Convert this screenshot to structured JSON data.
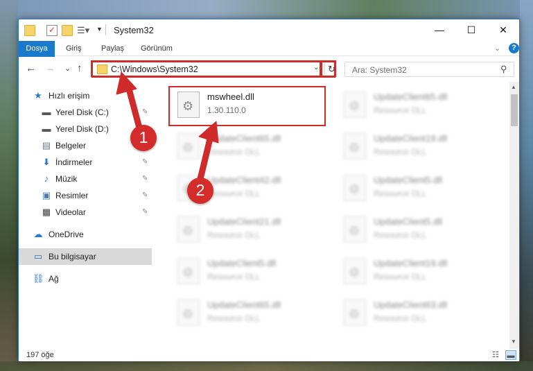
{
  "window": {
    "title": "System32",
    "minimize_glyph": "—",
    "maximize_glyph": "☐",
    "close_glyph": "✕"
  },
  "ribbon": {
    "tabs": [
      "Dosya",
      "Giriş",
      "Paylaş",
      "Görünüm"
    ],
    "expand_glyph": "⌄",
    "help_glyph": "?"
  },
  "nav": {
    "back_glyph": "←",
    "forward_glyph": "→",
    "recent_glyph": "⌄",
    "up_glyph": "↑",
    "address": "C:\\Windows\\System32",
    "address_dropdown_glyph": "⌄",
    "refresh_glyph": "↻",
    "search_placeholder": "Ara: System32",
    "search_icon": "search-icon"
  },
  "sidebar": {
    "items": [
      {
        "label": "Hızlı erişim",
        "icon": "★",
        "pinned": false
      },
      {
        "label": "Yerel Disk (C:)",
        "icon": "▬",
        "pinned": true
      },
      {
        "label": "Yerel Disk (D:)",
        "icon": "▬",
        "pinned": true
      },
      {
        "label": "Belgeler",
        "icon": "▤",
        "pinned": true
      },
      {
        "label": "İndirmeler",
        "icon": "⬇",
        "pinned": true
      },
      {
        "label": "Müzik",
        "icon": "♪",
        "pinned": true
      },
      {
        "label": "Resimler",
        "icon": "▣",
        "pinned": true
      },
      {
        "label": "Videolar",
        "icon": "▦",
        "pinned": true
      },
      {
        "label": "OneDrive",
        "icon": "☁",
        "pinned": false
      },
      {
        "label": "Bu bilgisayar",
        "icon": "▭",
        "pinned": false,
        "selected": true
      },
      {
        "label": "Ağ",
        "icon": "⛓",
        "pinned": false
      }
    ],
    "pin_glyph": "📌"
  },
  "files": [
    {
      "name": "mswheel.dll",
      "desc": "1.30.110.0",
      "highlighted": true
    },
    {
      "name": "UpdateClient65.dll",
      "desc": "Resource DLL"
    },
    {
      "name": "UpdateClient65.dll",
      "desc": "Resource DLL"
    },
    {
      "name": "UpdateClient19.dll",
      "desc": "Resource DLL"
    },
    {
      "name": "UpdateClient42.dll",
      "desc": "Resource DLL"
    },
    {
      "name": "UpdateClient5.dll",
      "desc": "Resource DLL"
    },
    {
      "name": "UpdateClient21.dll",
      "desc": "Resource DLL"
    },
    {
      "name": "UpdateClient5.dll",
      "desc": "Resource DLL"
    },
    {
      "name": "UpdateClient5.dll",
      "desc": "Resource DLL"
    },
    {
      "name": "UpdateClient19.dll",
      "desc": "Resource DLL"
    },
    {
      "name": "UpdateClient65.dll",
      "desc": "Resource DLL"
    },
    {
      "name": "UpdateClient63.dll",
      "desc": "Resource DLL"
    }
  ],
  "status": {
    "count": "197 öğe"
  },
  "annotations": {
    "badge1": "1",
    "badge2": "2",
    "color": "#cf2b2b"
  },
  "colors": {
    "accent": "#1979ca",
    "highlight_red": "#cf2b2b",
    "selected_bg": "#d9d9d9"
  }
}
